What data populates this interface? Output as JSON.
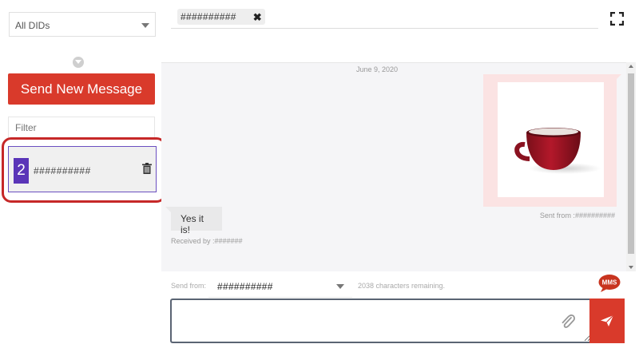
{
  "sidebar": {
    "did_filter": "All DIDs",
    "send_new_label": "Send New Message",
    "filter_placeholder": "Filter",
    "conversation": {
      "badge": "2",
      "number": "##########"
    }
  },
  "header": {
    "recipient_chip": "##########",
    "chip_remove": "✖"
  },
  "chat": {
    "date": "June 9, 2020",
    "sent": {
      "from": "Sent from :##########"
    },
    "received": {
      "text": "Yes it is!",
      "by": "Received by :#######"
    }
  },
  "compose": {
    "send_from_label": "Send from:",
    "send_from_value": "##########",
    "chars_remaining": "2038 characters remaining.",
    "mms_label": "MMS",
    "message_placeholder": ""
  },
  "colors": {
    "accent_red": "#d93a2b",
    "badge_purple": "#5a35b8"
  }
}
